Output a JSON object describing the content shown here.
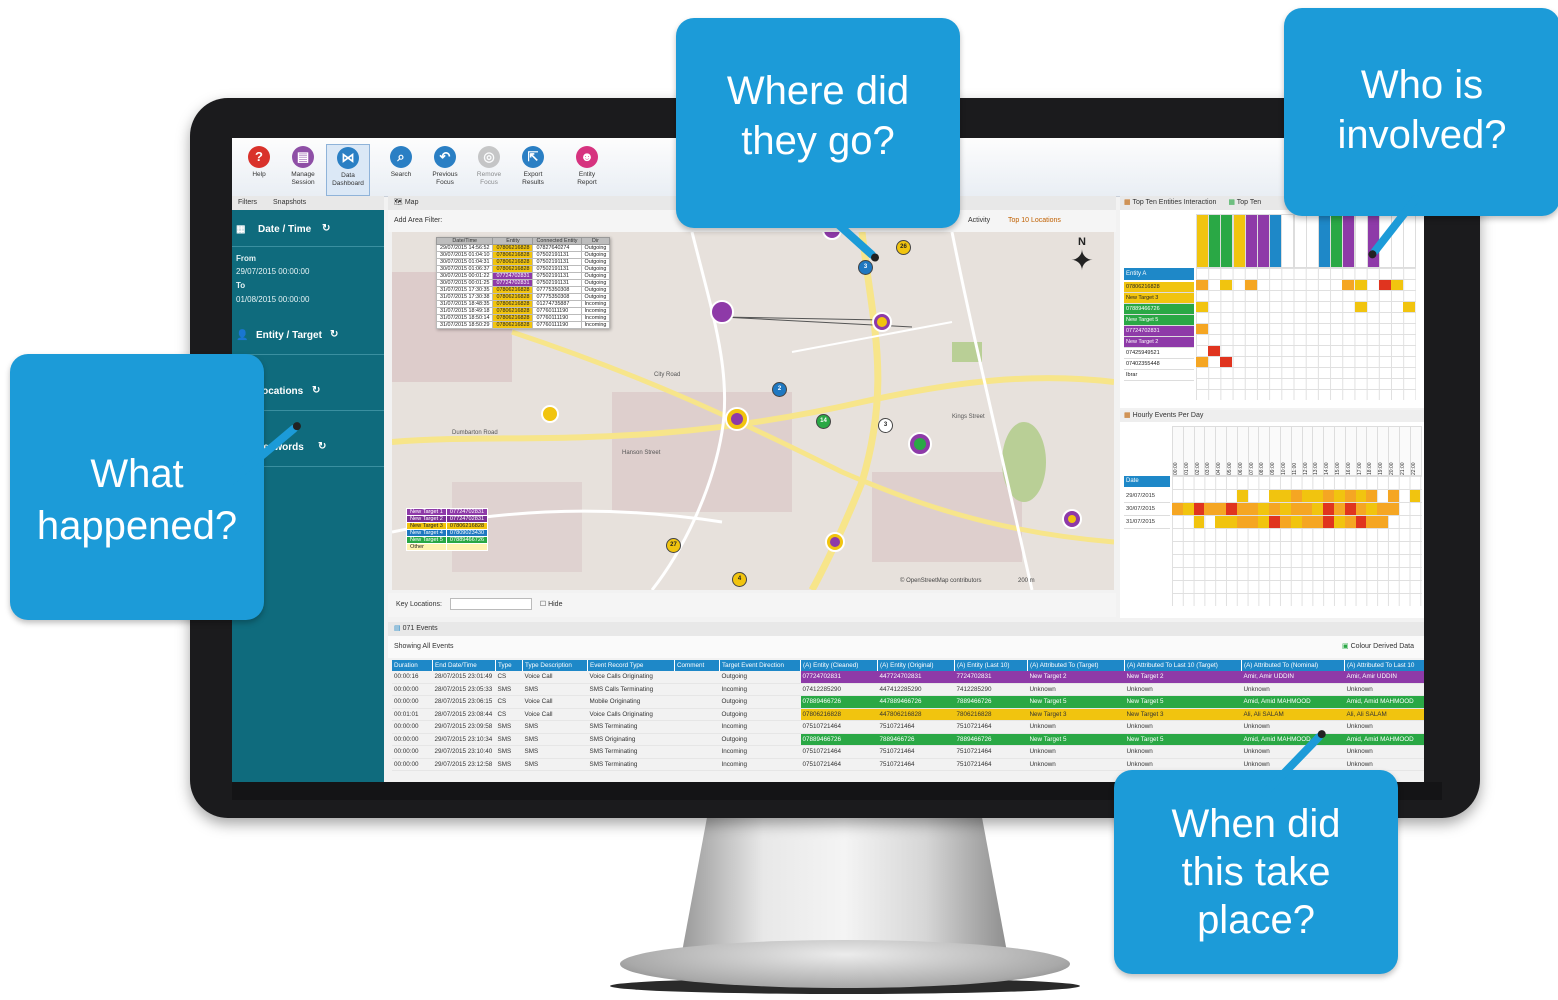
{
  "ribbon": {
    "buttons": [
      {
        "label_1": "Help",
        "label_2": "",
        "color": "#d9322b",
        "glyph": "?"
      },
      {
        "label_1": "Manage",
        "label_2": "Session",
        "color": "#8e4fa6",
        "glyph": "▤"
      },
      {
        "label_1": "Data",
        "label_2": "Dashboard",
        "color": "#2a7fc4",
        "glyph": "⋈"
      },
      {
        "label_1": "Search",
        "label_2": "",
        "color": "#2a7fc4",
        "glyph": "⌕"
      },
      {
        "label_1": "Previous",
        "label_2": "Focus",
        "color": "#2a7fc4",
        "glyph": "↶"
      },
      {
        "label_1": "Remove",
        "label_2": "Focus",
        "color": "#9e9e9e",
        "glyph": "◎"
      },
      {
        "label_1": "Export",
        "label_2": "Results",
        "color": "#2a7fc4",
        "glyph": "⇱"
      },
      {
        "label_1": "Entity",
        "label_2": "Report",
        "color": "#d6337f",
        "glyph": "☻"
      }
    ]
  },
  "sidebar": {
    "tab_filters": "Filters",
    "tab_snapshots": "Snapshots",
    "date_title": "Date / Time",
    "from_label": "From",
    "from_value": "29/07/2015 00:00:00",
    "to_label": "To",
    "to_value": "01/08/2015 00:00:00",
    "entity_title": "Entity / Target",
    "locations_title": "Locations",
    "keywords_title": "Keywords"
  },
  "map": {
    "tab": "Map",
    "area_filter": "Add Area Filter:",
    "right_tabs": [
      "Activity",
      "Top 10 Locations"
    ],
    "north": "N",
    "attribution": "© OpenStreetMap contributors",
    "scale": "200 m",
    "key_locations": "Key Locations:",
    "hide": "Hide",
    "popup_headers": [
      "Date/Time",
      "Entity",
      "Connected Entity",
      "Dir"
    ],
    "popup_rows": [
      [
        "29/07/2015 14:56:52",
        "07806216828",
        "07827640274",
        "Outgoing"
      ],
      [
        "30/07/2015 01:04:10",
        "07806216828",
        "07502191131",
        "Outgoing"
      ],
      [
        "30/07/2015 01:04:31",
        "07806216828",
        "07502191131",
        "Outgoing"
      ],
      [
        "30/07/2015 01:06:37",
        "07806216828",
        "07502191131",
        "Outgoing"
      ],
      [
        "30/07/2015 00:01:22",
        "07724702831",
        "07502191131",
        "Outgoing"
      ],
      [
        "30/07/2015 00:01:25",
        "07724702831",
        "07502191131",
        "Outgoing"
      ],
      [
        "31/07/2015 17:30:35",
        "07806216828",
        "07775350308",
        "Outgoing"
      ],
      [
        "31/07/2015 17:30:38",
        "07806216828",
        "07775350308",
        "Outgoing"
      ],
      [
        "31/07/2015 18:48:35",
        "07806216828",
        "01274735887",
        "Incoming"
      ],
      [
        "31/07/2015 18:49:18",
        "07806216828",
        "07760111190",
        "Incoming"
      ],
      [
        "31/07/2015 18:50:14",
        "07806216828",
        "07760111190",
        "Incoming"
      ],
      [
        "31/07/2015 18:50:29",
        "07806216828",
        "07760111190",
        "Incoming"
      ]
    ],
    "street_labels": [
      "Dumbarton Road",
      "Hanson Street",
      "City Road",
      "Kings Street"
    ],
    "legend": [
      {
        "name": "New Target 1",
        "number": "07724702831",
        "color": "#8e3aa8"
      },
      {
        "name": "New Target 2",
        "number": "07724702831",
        "color": "#7a2f95"
      },
      {
        "name": "New Target 3",
        "number": "07806216828",
        "color": "#f1c40f"
      },
      {
        "name": "New Target 4",
        "number": "07809023430",
        "color": "#1f78c1"
      },
      {
        "name": "New Target 5",
        "number": "07889466726",
        "color": "#2aa845"
      },
      {
        "name": "Other",
        "number": "",
        "color": "#fff3b0"
      }
    ],
    "markers": [
      {
        "label": "26",
        "color": "#f1c40f"
      },
      {
        "label": "3",
        "color": "#1f78c1"
      },
      {
        "label": "2",
        "color": "#1f78c1"
      },
      {
        "label": "14",
        "color": "#2aa845"
      },
      {
        "label": "27",
        "color": "#f1c40f"
      },
      {
        "label": "3",
        "color": "#fff"
      },
      {
        "label": "4",
        "color": "#f1c40f"
      }
    ]
  },
  "right": {
    "tab1": "Top Ten Entities Interaction",
    "tab2": "Top Ten",
    "entity_a": "Entity A",
    "entity_rows": [
      "07806216828",
      "New Target 3",
      "07889466726",
      "New Target 5",
      "07724702831",
      "New Target 2",
      "07425949521",
      "07402355448",
      "Ibrar"
    ],
    "hourly_title": "Hourly Events Per Day",
    "date_header": "Date",
    "dates": [
      "29/07/2015",
      "30/07/2015",
      "31/07/2015"
    ],
    "hours": [
      "00:00",
      "01:00",
      "02:00",
      "03:00",
      "04:00",
      "05:00",
      "06:00",
      "07:00",
      "08:00",
      "09:00",
      "10:00",
      "11:00",
      "12:00",
      "13:00",
      "14:00",
      "15:00",
      "16:00",
      "17:00",
      "18:00",
      "19:00",
      "20:00",
      "21:00",
      "22:00"
    ]
  },
  "events": {
    "tab": "071 Events",
    "showing": "Showing All Events",
    "colour_derived": "Colour Derived Data",
    "columns": [
      "Duration",
      "End Date/Time",
      "Type",
      "Type Description",
      "Event Record Type",
      "Comment",
      "Target Event Direction",
      "(A) Entity (Cleaned)",
      "(A) Entity (Original)",
      "(A) Entity (Last 10)",
      "(A) Attributed To (Target)",
      "(A) Attributed To Last 10 (Target)",
      "(A) Attributed To (Nominal)",
      "(A) Attributed To Last 10"
    ],
    "rows": [
      {
        "cells": [
          "00:00:16",
          "28/07/2015 23:01:49",
          "CS",
          "Voice Call",
          "Voice Calls Originating",
          "",
          "Outgoing",
          "07724702831",
          "447724702831",
          "7724702831",
          "New Target 2",
          "New Target 2",
          "Amir, Amir UDDIN",
          "Amir, Amir UDDIN"
        ],
        "highlight": "#8e3aa8",
        "text": "#fff"
      },
      {
        "cells": [
          "00:00:00",
          "28/07/2015 23:05:33",
          "SMS",
          "SMS",
          "SMS Calls Terminating",
          "",
          "Incoming",
          "07412285290",
          "447412285290",
          "7412285290",
          "Unknown",
          "Unknown",
          "Unknown",
          "Unknown"
        ],
        "highlight": "",
        "text": "#333"
      },
      {
        "cells": [
          "00:00:00",
          "28/07/2015 23:06:15",
          "CS",
          "Voice Call",
          "Mobile Originating",
          "",
          "Outgoing",
          "07889466726",
          "447889466726",
          "7889466726",
          "New Target 5",
          "New Target 5",
          "Amid, Amid MAHMOOD",
          "Amid, Amid MAHMOOD"
        ],
        "highlight": "#2aa845",
        "text": "#fff"
      },
      {
        "cells": [
          "00:01:01",
          "28/07/2015 23:08:44",
          "CS",
          "Voice Call",
          "Voice Calls Originating",
          "",
          "Outgoing",
          "07806216828",
          "447806216828",
          "7806216828",
          "New Target 3",
          "New Target 3",
          "Ali, Ali SALAM",
          "Ali, Ali SALAM"
        ],
        "highlight": "#f1c40f",
        "text": "#333"
      },
      {
        "cells": [
          "00:00:00",
          "29/07/2015 23:09:58",
          "SMS",
          "SMS",
          "SMS Terminating",
          "",
          "Incoming",
          "07510721464",
          "7510721464",
          "7510721464",
          "Unknown",
          "Unknown",
          "Unknown",
          "Unknown"
        ],
        "highlight": "",
        "text": "#333"
      },
      {
        "cells": [
          "00:00:00",
          "29/07/2015 23:10:34",
          "SMS",
          "SMS",
          "SMS Originating",
          "",
          "Outgoing",
          "07889466726",
          "7889466726",
          "7889466726",
          "New Target 5",
          "New Target 5",
          "Amid, Amid MAHMOOD",
          "Amid, Amid MAHMOOD"
        ],
        "highlight": "#2aa845",
        "text": "#fff"
      },
      {
        "cells": [
          "00:00:00",
          "29/07/2015 23:10:40",
          "SMS",
          "SMS",
          "SMS Terminating",
          "",
          "Incoming",
          "07510721464",
          "7510721464",
          "7510721464",
          "Unknown",
          "Unknown",
          "Unknown",
          "Unknown"
        ],
        "highlight": "",
        "text": "#333"
      },
      {
        "cells": [
          "00:00:00",
          "29/07/2015 23:12:58",
          "SMS",
          "SMS",
          "SMS Terminating",
          "",
          "Incoming",
          "07510721464",
          "7510721464",
          "7510721464",
          "Unknown",
          "Unknown",
          "Unknown",
          "Unknown"
        ],
        "highlight": "",
        "text": "#333"
      }
    ]
  },
  "callouts": {
    "where": "Where did they go?",
    "who": "Who is involved?",
    "what": "What happened?",
    "when": "When did this take place?"
  },
  "colors": {
    "accent": "#1c9bd8",
    "sidebar": "#0f6b7d",
    "header_blue": "#1e88c8"
  }
}
